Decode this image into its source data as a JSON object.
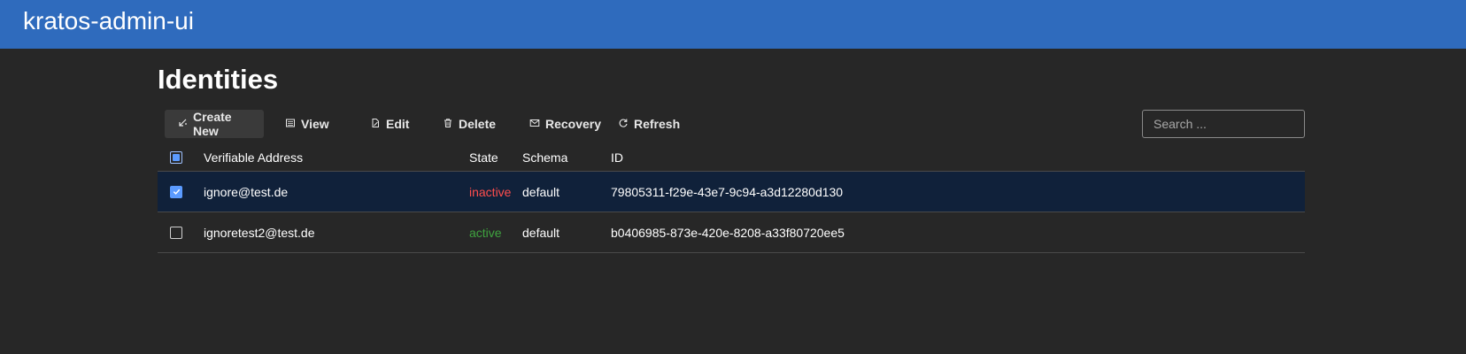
{
  "app": {
    "title": "kratos-admin-ui"
  },
  "page": {
    "title": "Identities"
  },
  "toolbar": {
    "create_new": "Create New",
    "view": "View",
    "edit": "Edit",
    "delete": "Delete",
    "recovery": "Recovery",
    "refresh": "Refresh",
    "search_placeholder": "Search ..."
  },
  "table": {
    "columns": {
      "address": "Verifiable Address",
      "state": "State",
      "schema": "Schema",
      "id": "ID"
    },
    "rows": [
      {
        "selected": true,
        "address": "ignore@test.de",
        "state": "inactive",
        "schema": "default",
        "id": "79805311-f29e-43e7-9c94-a3d12280d130"
      },
      {
        "selected": false,
        "address": "ignoretest2@test.de",
        "state": "active",
        "schema": "default",
        "id": "b0406985-873e-420e-8208-a33f80720ee5"
      }
    ]
  },
  "colors": {
    "header_bg": "#2f6bbd",
    "page_bg": "#272727",
    "selected_row_bg": "#10213a",
    "state_inactive": "#ff4d4d",
    "state_active": "#3fa33f",
    "checkbox_accent": "#5b9bff"
  }
}
